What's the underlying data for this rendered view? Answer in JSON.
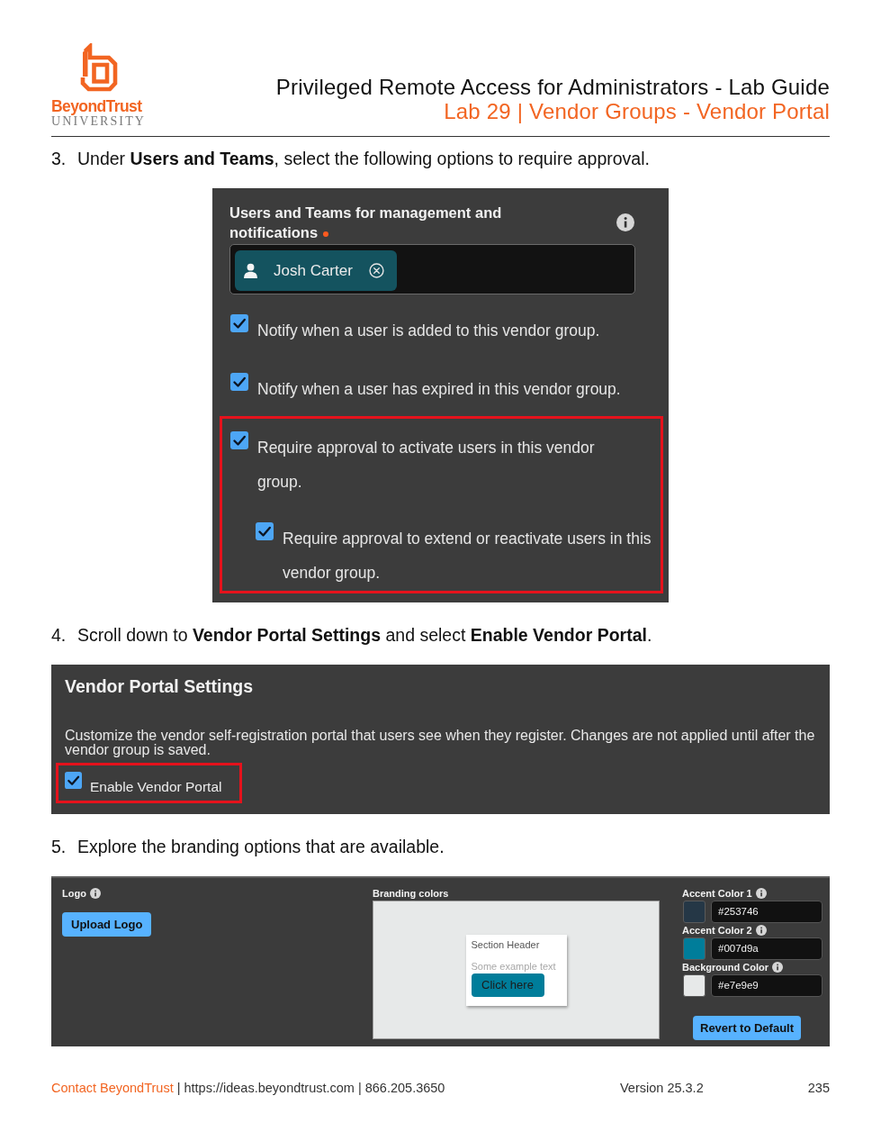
{
  "header": {
    "logo": {
      "brand": "BeyondTrust",
      "tagline": "UNIVERSITY"
    },
    "title": "Privileged Remote Access for Administrators - Lab Guide",
    "subtitle": "Lab 29 | Vendor Groups - Vendor Portal"
  },
  "steps": [
    {
      "number": "3.",
      "text": "Under **Users and Teams**, select the following options to require approval.",
      "screenshot": {
        "kind": "users_teams",
        "heading": "Users and Teams for management and notifications",
        "required": true,
        "members": [
          {
            "name": "Josh Carter"
          }
        ],
        "options": [
          {
            "label": "Notify when a user is added to this vendor group.",
            "checked": true,
            "highlighted": false
          },
          {
            "label": "Notify when a user has expired in this vendor group.",
            "checked": true,
            "highlighted": false
          },
          {
            "label": "Require approval to activate users in this vendor group.",
            "checked": true,
            "highlighted": true,
            "children": [
              {
                "label": "Require approval to extend or reactivate users in this vendor group.",
                "checked": true,
                "highlighted": false
              }
            ]
          }
        ]
      }
    },
    {
      "number": "4.",
      "text": "Scroll down to **Vendor Portal Settings** and select **Enable Vendor Portal**.",
      "screenshot": {
        "kind": "vendor_portal",
        "title": "Vendor Portal Settings",
        "description": "Customize the vendor self-registration portal that users see when they register. Changes are not applied until after the vendor group is saved.",
        "option": {
          "label": "Enable Vendor Portal",
          "checked": true,
          "highlighted": true
        }
      }
    },
    {
      "number": "5.",
      "text": "Explore the branding options that are available.",
      "screenshot": {
        "kind": "branding",
        "logo": {
          "label": "Logo",
          "button": "Upload Logo"
        },
        "branding_colors": {
          "label": "Branding colors",
          "preview": {
            "header": "Section Header",
            "text": "Some example text",
            "button": "Click here"
          }
        },
        "colors": [
          {
            "label": "Accent Color 1",
            "value": "#253746",
            "color": "#253746"
          },
          {
            "label": "Accent Color 2",
            "value": "#007d9a",
            "color": "#007d9a"
          },
          {
            "label": "Background Color",
            "value": "#e7e9e9",
            "color": "#e7e9e9"
          }
        ],
        "revert_button": "Revert to Default"
      }
    }
  ],
  "footer": {
    "contact_link": "Contact BeyondTrust",
    "details": "| https://ideas.beyondtrust.com | 866.205.3650",
    "version": "Version 25.3.2",
    "page": "235"
  }
}
